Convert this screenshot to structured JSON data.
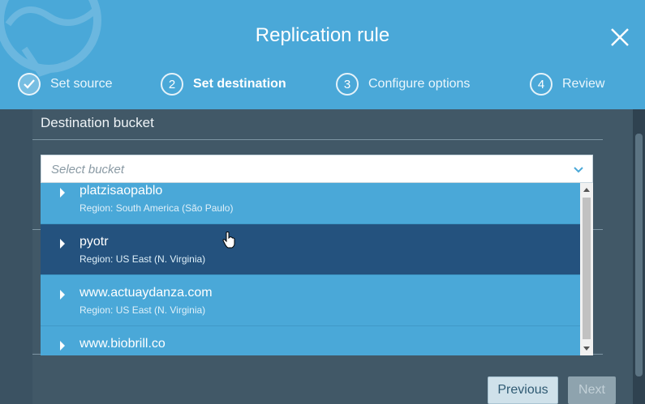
{
  "dialog": {
    "title": "Replication rule",
    "close_icon": "close-icon"
  },
  "steps": [
    {
      "number": "",
      "label": "Set source",
      "state": "done",
      "icon": "check-icon"
    },
    {
      "number": "2",
      "label": "Set destination",
      "state": "active"
    },
    {
      "number": "3",
      "label": "Configure options",
      "state": "pending"
    },
    {
      "number": "4",
      "label": "Review",
      "state": "pending"
    }
  ],
  "destination": {
    "section_label": "Destination bucket",
    "select_placeholder": "Select bucket",
    "buckets": [
      {
        "name": "platzisaopablo",
        "region": "Region: South America (São Paulo)",
        "selected": false
      },
      {
        "name": "pyotr",
        "region": "Region: US East (N. Virginia)",
        "selected": true
      },
      {
        "name": "www.actuaydanza.com",
        "region": "Region: US East (N. Virginia)",
        "selected": false
      },
      {
        "name": "www.biobrill.co",
        "region": "",
        "selected": false
      }
    ]
  },
  "footer": {
    "previous_label": "Previous",
    "next_label": "Next"
  },
  "colors": {
    "header": "#4aa8d8",
    "selected_row": "#24527e",
    "background": "#3e5566"
  }
}
